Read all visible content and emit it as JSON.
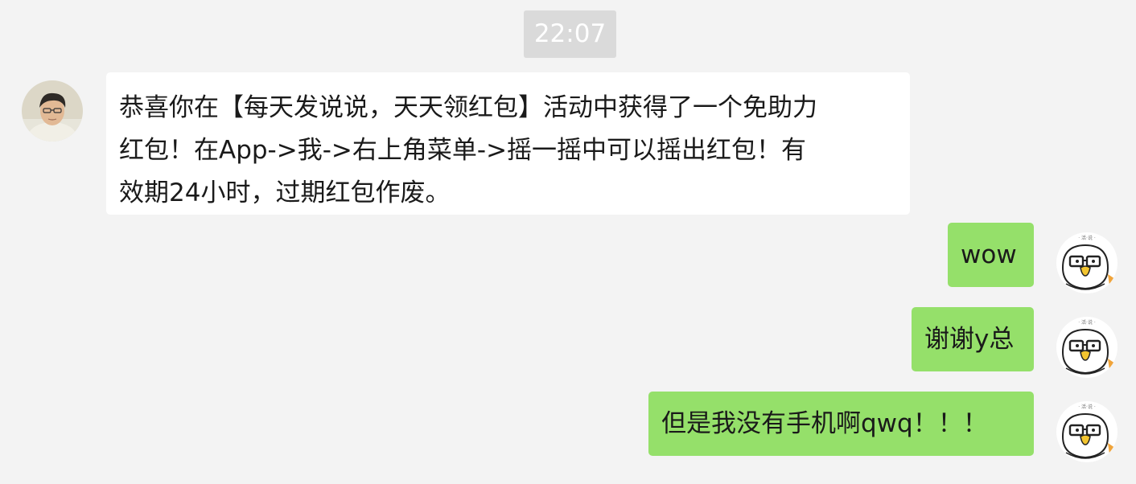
{
  "chat": {
    "timestamp": "22:07",
    "incoming": {
      "sender_avatar_icon": "user-photo-avatar-icon",
      "text": "恭喜你在【每天发说说，天天领红包】活动中获得了一个免助力\n红包！在App->我->右上角菜单->摇一摇中可以摇出红包！有\n效期24小时，过期红包作废。"
    },
    "outgoing": [
      {
        "text": "wow"
      },
      {
        "text": "谢谢y总"
      },
      {
        "text": "但是我没有手机啊qwq！！！"
      }
    ],
    "self_avatar_icon": "cartoon-duck-glasses-avatar-icon"
  },
  "colors": {
    "background": "#f3f3f3",
    "timestamp_bg": "#dadada",
    "incoming_bubble": "#ffffff",
    "outgoing_bubble": "#95e06a"
  }
}
